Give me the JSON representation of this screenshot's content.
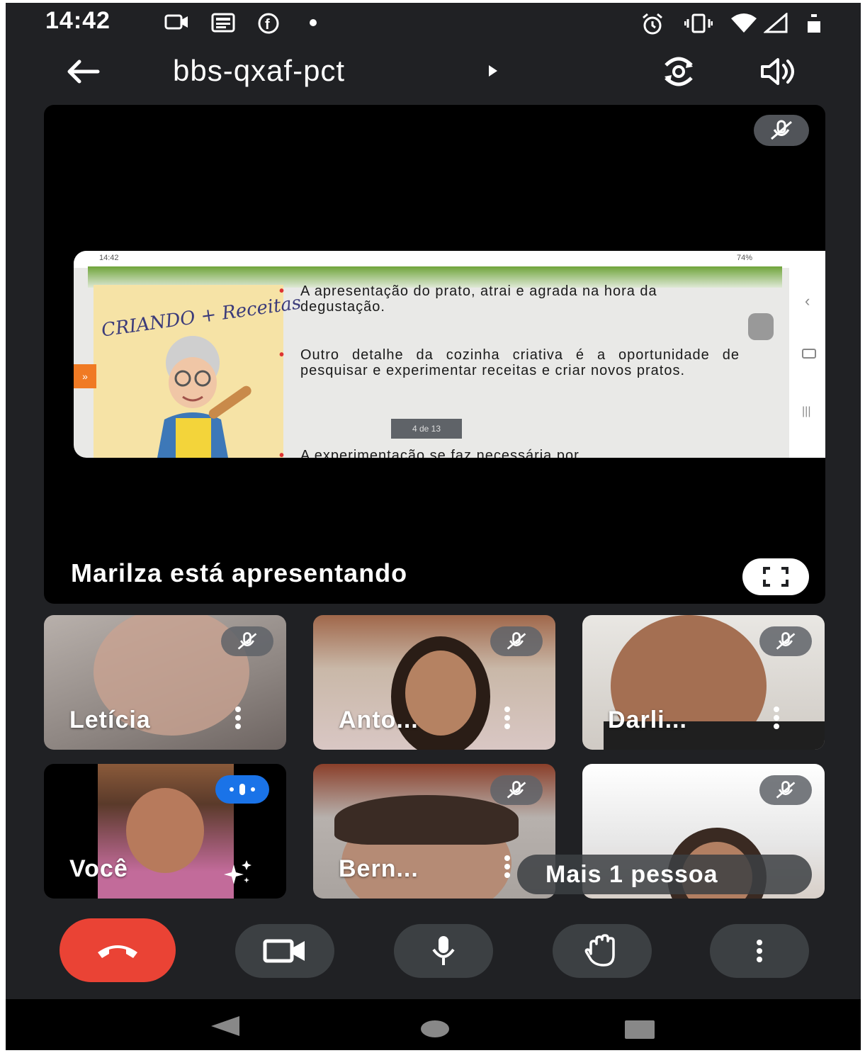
{
  "status_bar": {
    "time": "14:42",
    "icons": [
      "video-notification-icon",
      "news-icon",
      "facebook-icon",
      "dot-icon",
      "alarm-icon",
      "vibrate-icon",
      "wifi-icon",
      "signal-icon",
      "battery-icon"
    ]
  },
  "top_bar": {
    "meeting_code": "bbs-qxaf-pct",
    "icons": [
      "back-arrow-icon",
      "caret-right-icon",
      "switch-camera-icon",
      "speaker-icon"
    ]
  },
  "presentation": {
    "slide": {
      "status_time": "14:42",
      "status_right": "74%",
      "art_title": "CRIANDO + Receitas",
      "bullets": [
        "A apresentação do prato, atrai e agrada na hora da degustação.",
        "Outro detalhe da cozinha criativa é a oportunidade de pesquisar e experimentar receitas e criar novos pratos.",
        "A experimentação se faz necessária por"
      ],
      "page_indicator": "4 de 13",
      "orange_tab": "»"
    },
    "presenter_text": "Marilza está apresentando"
  },
  "participants": [
    {
      "name": "Letícia",
      "muted": true
    },
    {
      "name": "Anto...",
      "muted": true
    },
    {
      "name": "Darli...",
      "muted": true
    },
    {
      "name": "Você",
      "muted": false,
      "speaking": true
    },
    {
      "name": "Bern...",
      "muted": true
    },
    {
      "name": "",
      "muted": true
    }
  ],
  "more_people": "Mais 1 pessoa",
  "colors": {
    "background": "#202124",
    "end_call": "#ea4335",
    "control": "#3c4043",
    "speaking": "#1a73e8"
  }
}
